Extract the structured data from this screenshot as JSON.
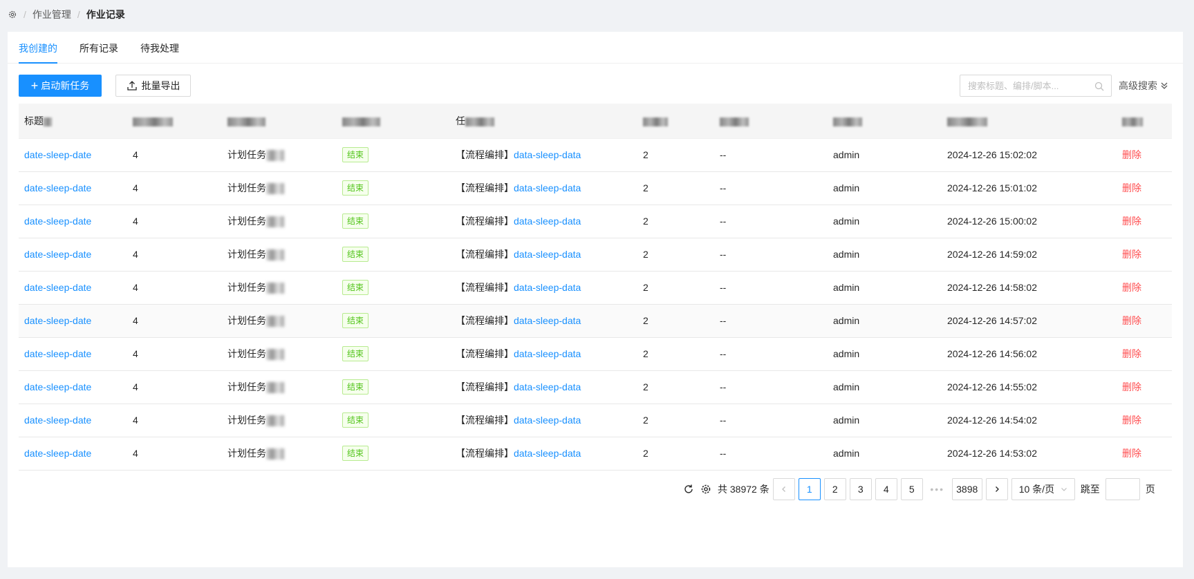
{
  "breadcrumb": {
    "items": [
      "作业管理",
      "作业记录"
    ]
  },
  "tabs": [
    {
      "label": "我创建的",
      "active": true
    },
    {
      "label": "所有记录",
      "active": false
    },
    {
      "label": "待我处理",
      "active": false
    }
  ],
  "toolbar": {
    "new_task_label": "启动新任务",
    "export_label": "批量导出",
    "search_placeholder": "搜索标题、编排/脚本...",
    "advanced_search_label": "高级搜索"
  },
  "table": {
    "headers": [
      "标题",
      "",
      "",
      "",
      "任",
      "",
      "",
      "",
      "",
      ""
    ],
    "rows": [
      {
        "title": "date-sleep-date",
        "num": "4",
        "trigger": "计划任务",
        "status": "结束",
        "prefix": "【流程编排】",
        "flow": "data-sleep-data",
        "count": "2",
        "dash": "--",
        "user": "admin",
        "time": "2024-12-26 15:02:02",
        "action": "删除"
      },
      {
        "title": "date-sleep-date",
        "num": "4",
        "trigger": "计划任务",
        "status": "结束",
        "prefix": "【流程编排】",
        "flow": "data-sleep-data",
        "count": "2",
        "dash": "--",
        "user": "admin",
        "time": "2024-12-26 15:01:02",
        "action": "删除"
      },
      {
        "title": "date-sleep-date",
        "num": "4",
        "trigger": "计划任务",
        "status": "结束",
        "prefix": "【流程编排】",
        "flow": "data-sleep-data",
        "count": "2",
        "dash": "--",
        "user": "admin",
        "time": "2024-12-26 15:00:02",
        "action": "删除"
      },
      {
        "title": "date-sleep-date",
        "num": "4",
        "trigger": "计划任务",
        "status": "结束",
        "prefix": "【流程编排】",
        "flow": "data-sleep-data",
        "count": "2",
        "dash": "--",
        "user": "admin",
        "time": "2024-12-26 14:59:02",
        "action": "删除"
      },
      {
        "title": "date-sleep-date",
        "num": "4",
        "trigger": "计划任务",
        "status": "结束",
        "prefix": "【流程编排】",
        "flow": "data-sleep-data",
        "count": "2",
        "dash": "--",
        "user": "admin",
        "time": "2024-12-26 14:58:02",
        "action": "删除"
      },
      {
        "title": "date-sleep-date",
        "num": "4",
        "trigger": "计划任务",
        "status": "结束",
        "prefix": "【流程编排】",
        "flow": "data-sleep-data",
        "count": "2",
        "dash": "--",
        "user": "admin",
        "time": "2024-12-26 14:57:02",
        "action": "删除"
      },
      {
        "title": "date-sleep-date",
        "num": "4",
        "trigger": "计划任务",
        "status": "结束",
        "prefix": "【流程编排】",
        "flow": "data-sleep-data",
        "count": "2",
        "dash": "--",
        "user": "admin",
        "time": "2024-12-26 14:56:02",
        "action": "删除"
      },
      {
        "title": "date-sleep-date",
        "num": "4",
        "trigger": "计划任务",
        "status": "结束",
        "prefix": "【流程编排】",
        "flow": "data-sleep-data",
        "count": "2",
        "dash": "--",
        "user": "admin",
        "time": "2024-12-26 14:55:02",
        "action": "删除"
      },
      {
        "title": "date-sleep-date",
        "num": "4",
        "trigger": "计划任务",
        "status": "结束",
        "prefix": "【流程编排】",
        "flow": "data-sleep-data",
        "count": "2",
        "dash": "--",
        "user": "admin",
        "time": "2024-12-26 14:54:02",
        "action": "删除"
      },
      {
        "title": "date-sleep-date",
        "num": "4",
        "trigger": "计划任务",
        "status": "结束",
        "prefix": "【流程编排】",
        "flow": "data-sleep-data",
        "count": "2",
        "dash": "--",
        "user": "admin",
        "time": "2024-12-26 14:53:02",
        "action": "删除"
      }
    ]
  },
  "pagination": {
    "total_text": "共 38972 条",
    "pages": [
      "1",
      "2",
      "3",
      "4",
      "5"
    ],
    "current": "1",
    "ellipsis": "•••",
    "last_page": "3898",
    "page_size": "10 条/页",
    "jump_label": "跳至",
    "jump_unit": "页"
  },
  "colors": {
    "primary": "#1890ff",
    "success": "#52c41a",
    "danger": "#ff4d4f"
  },
  "icons": [
    "settings-icon",
    "plus-icon",
    "upload-icon",
    "search-icon",
    "double-chevron-down-icon",
    "refresh-icon",
    "gear-icon",
    "chevron-left-icon",
    "chevron-right-icon",
    "chevron-down-icon"
  ]
}
